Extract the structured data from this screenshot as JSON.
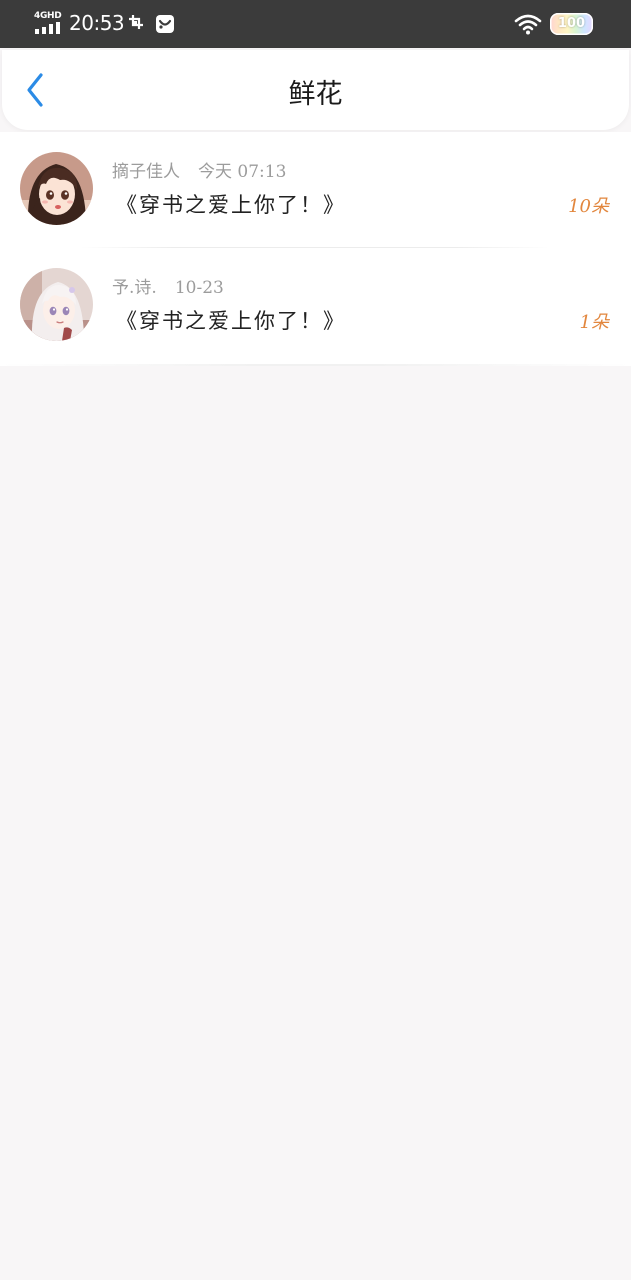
{
  "status_bar": {
    "network": "4GHD",
    "time": "20:53",
    "notification_icons": [
      "screenshot-icon",
      "chat-app-icon"
    ],
    "wifi_icon": "wifi-icon",
    "battery_level": "100"
  },
  "header": {
    "back_icon": "chevron-left-icon",
    "title": "鲜花"
  },
  "flowers": [
    {
      "user": "摘子佳人",
      "date": "今天 07:13",
      "book": "《穿书之爱上你了！》",
      "count": "10朵",
      "avatar": "anime-girl-brown-hair-avatar"
    },
    {
      "user": "予.诗.",
      "date": "10-23",
      "book": "《穿书之爱上你了！》",
      "count": "1朵",
      "avatar": "anime-girl-white-hair-avatar"
    }
  ],
  "colors": {
    "accent_blue": "#2b8be6",
    "count_orange": "#e2863d",
    "status_bar": "#3b3b3b",
    "page_background": "#f8f6f7"
  }
}
